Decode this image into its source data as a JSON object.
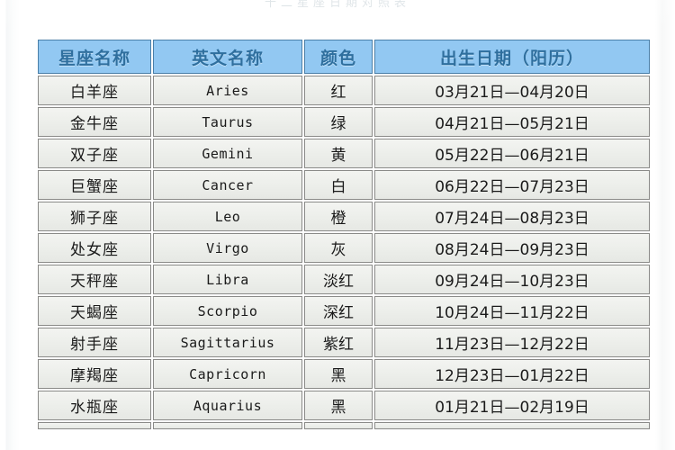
{
  "clipped_title": "十二星座日期对照表",
  "table": {
    "headers": [
      {
        "label": "星座名称"
      },
      {
        "label": "英文名称"
      },
      {
        "label": "颜色"
      },
      {
        "label": "出生日期（阳历）"
      }
    ],
    "rows": [
      {
        "name": "白羊座",
        "english": "Aries",
        "color": "红",
        "date": "03月21日—04月20日"
      },
      {
        "name": "金牛座",
        "english": "Taurus",
        "color": "绿",
        "date": "04月21日—05月21日"
      },
      {
        "name": "双子座",
        "english": "Gemini",
        "color": "黄",
        "date": "05月22日—06月21日"
      },
      {
        "name": "巨蟹座",
        "english": "Cancer",
        "color": "白",
        "date": "06月22日—07月23日"
      },
      {
        "name": "狮子座",
        "english": "Leo",
        "color": "橙",
        "date": "07月24日—08月23日"
      },
      {
        "name": "处女座",
        "english": "Virgo",
        "color": "灰",
        "date": "08月24日—09月23日"
      },
      {
        "name": "天秤座",
        "english": "Libra",
        "color": "淡红",
        "date": "09月24日—10月23日"
      },
      {
        "name": "天蝎座",
        "english": "Scorpio",
        "color": "深红",
        "date": "10月24日—11月22日"
      },
      {
        "name": "射手座",
        "english": "Sagittarius",
        "color": "紫红",
        "date": "11月23日—12月22日"
      },
      {
        "name": "摩羯座",
        "english": "Capricorn",
        "color": "黑",
        "date": "12月23日—01月22日"
      },
      {
        "name": "水瓶座",
        "english": "Aquarius",
        "color": "黑",
        "date": "01月21日—02月19日"
      }
    ],
    "clipped_row": {
      "name": "",
      "english": "",
      "color": "",
      "date": ""
    }
  },
  "colors": {
    "header_background": "#92c8f2",
    "header_text": "#2f6f9e",
    "header_border": "#4a7fa8",
    "cell_background": "#eff0ec",
    "cell_border": "#8a8a88",
    "cell_text": "#1a1a1a",
    "page_background": "#ffffff"
  }
}
